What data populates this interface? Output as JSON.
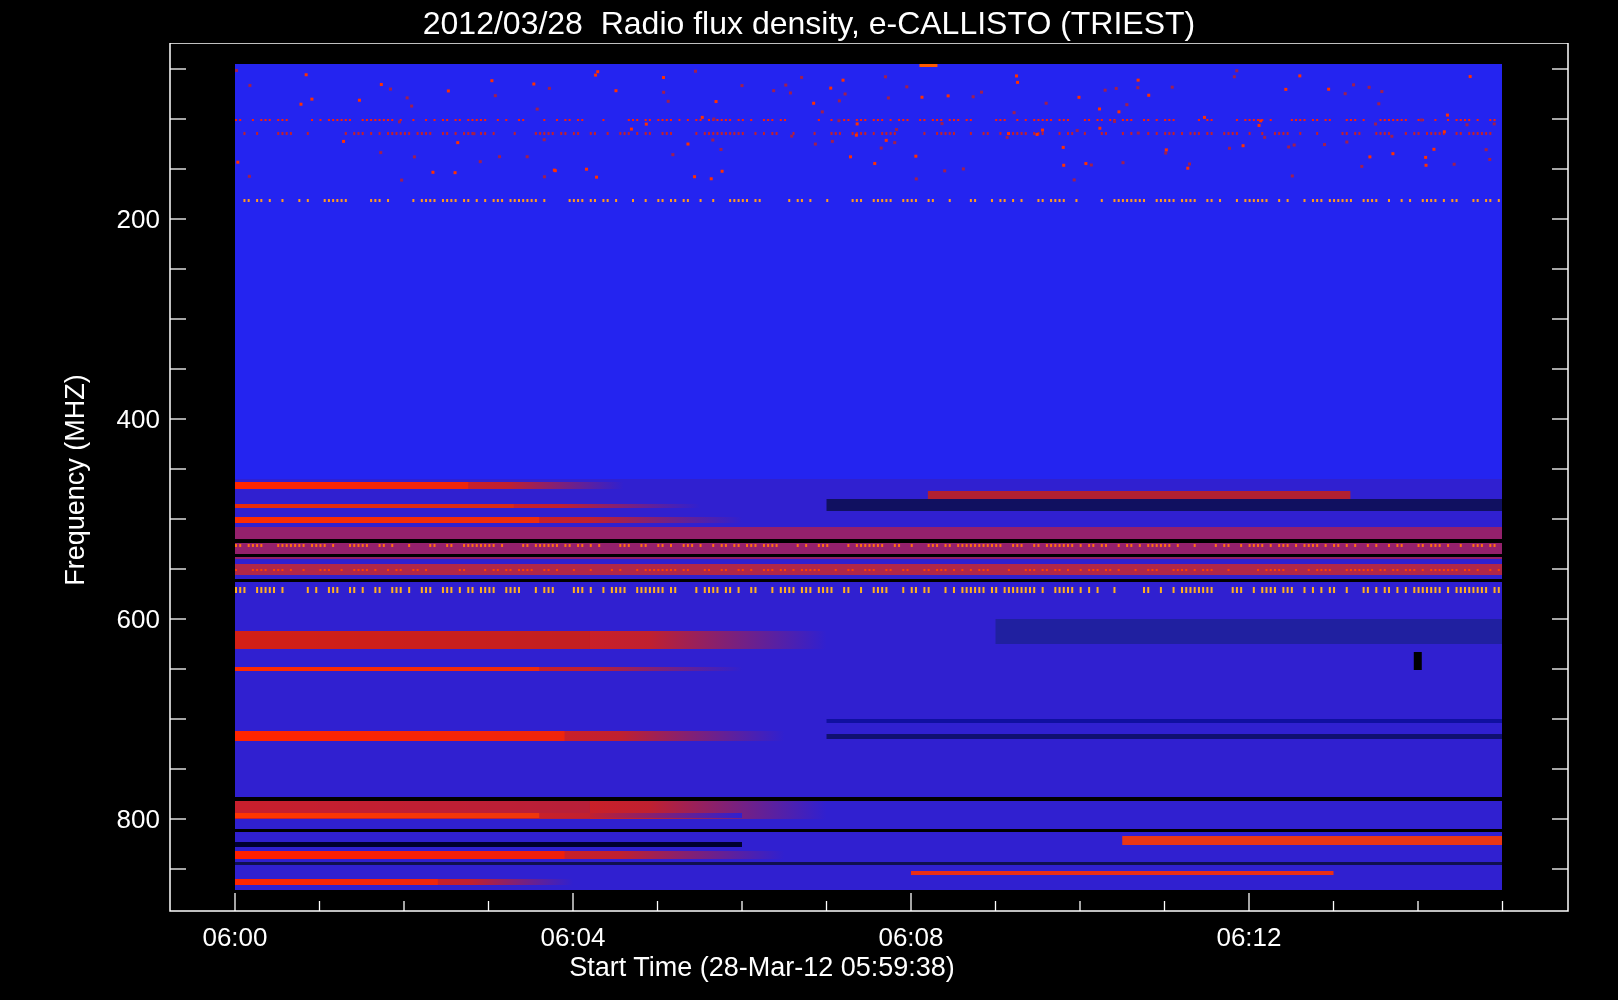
{
  "title": "2012/03/28  Radio flux density, e-CALLISTO (TRIEST)",
  "y_axis": {
    "label": "Frequency (MHZ)",
    "ticks": [
      "200",
      "400",
      "600",
      "800"
    ]
  },
  "x_axis": {
    "label": "Start Time (28-Mar-12 05:59:38)",
    "ticks": [
      "06:00",
      "06:04",
      "06:08",
      "06:12"
    ]
  }
}
